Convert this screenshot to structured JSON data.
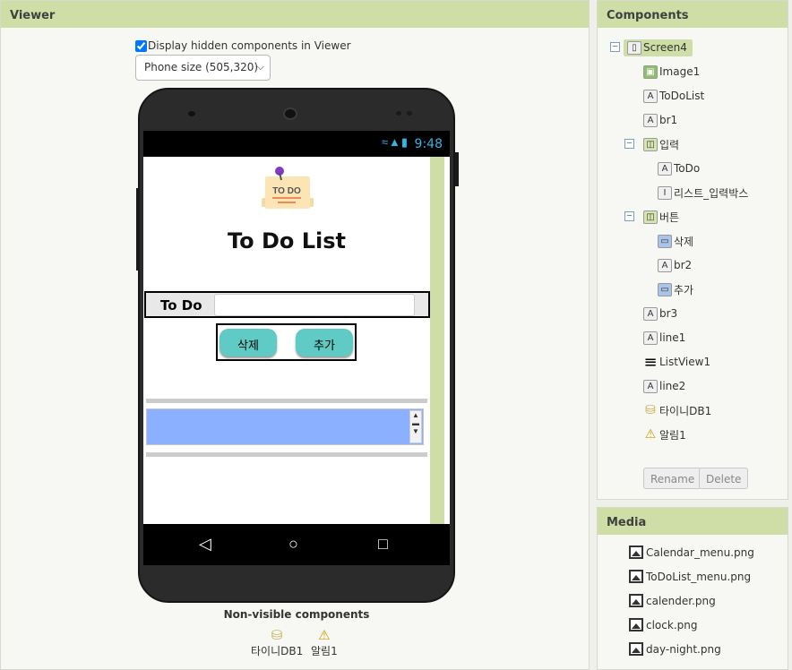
{
  "viewer": {
    "title": "Viewer",
    "hidden_checkbox_label": "Display hidden components in Viewer",
    "size_select": "Phone size (505,320)",
    "status_time": "9:48",
    "app": {
      "image_text": "TO DO",
      "title": "To Do List",
      "input_label": "To Do",
      "delete_button": "삭제",
      "add_button": "추가"
    },
    "nonvisible_title": "Non-visible components",
    "nonvisible": [
      {
        "label": "타이니DB1",
        "icon": "database-icon"
      },
      {
        "label": "알림1",
        "icon": "warning-icon"
      }
    ]
  },
  "components": {
    "title": "Components",
    "tree": [
      {
        "label": "Screen4",
        "icon": "screen-icon",
        "level": 0,
        "toggle": "⊖"
      },
      {
        "label": "Image1",
        "icon": "image-icon",
        "level": 1
      },
      {
        "label": "ToDoList",
        "icon": "label-icon",
        "level": 1
      },
      {
        "label": "br1",
        "icon": "label-icon",
        "level": 1
      },
      {
        "label": "입력",
        "icon": "arrangement-icon",
        "level": 1,
        "toggle": "⊖"
      },
      {
        "label": "ToDo",
        "icon": "label-icon",
        "level": 2
      },
      {
        "label": "리스트_입력박스",
        "icon": "textbox-icon",
        "level": 2
      },
      {
        "label": "버튼",
        "icon": "arrangement-icon",
        "level": 1,
        "toggle": "⊖"
      },
      {
        "label": "삭제",
        "icon": "button-icon",
        "level": 2
      },
      {
        "label": "br2",
        "icon": "label-icon",
        "level": 2
      },
      {
        "label": "추가",
        "icon": "button-icon",
        "level": 2
      },
      {
        "label": "br3",
        "icon": "label-icon",
        "level": 1
      },
      {
        "label": "line1",
        "icon": "label-icon",
        "level": 1
      },
      {
        "label": "ListView1",
        "icon": "listview-icon",
        "level": 1
      },
      {
        "label": "line2",
        "icon": "label-icon",
        "level": 1
      },
      {
        "label": "타이니DB1",
        "icon": "database-icon",
        "level": 1
      },
      {
        "label": "알림1",
        "icon": "warning-icon",
        "level": 1
      }
    ],
    "rename_button": "Rename",
    "delete_button": "Delete"
  },
  "media": {
    "title": "Media",
    "files": [
      "Calendar_menu.png",
      "ToDoList_menu.png",
      "calender.png",
      "clock.png",
      "day-night.png"
    ]
  }
}
